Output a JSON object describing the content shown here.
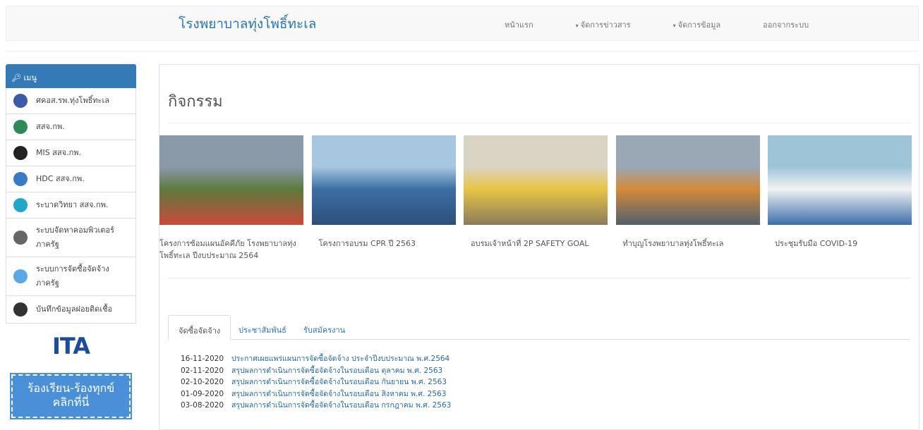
{
  "site": {
    "brand": "โรงพยาบาลทุ่งโพธิ์ทะเล"
  },
  "nav": [
    {
      "label": "หน้าแรก",
      "dropdown": false
    },
    {
      "label": "จัดการข่าวสาร",
      "dropdown": true
    },
    {
      "label": "จัดการข้อมูล",
      "dropdown": true
    },
    {
      "label": "ออกจากระบบ",
      "dropdown": false
    }
  ],
  "sidebar": {
    "header": "เมนู",
    "items": [
      {
        "label": "ศคอส.รพ.ทุ่งโพธิ์ทะเล",
        "icon": "emblem-icon",
        "color": "#3b5aa8"
      },
      {
        "label": "สสจ.กพ.",
        "icon": "health-office-icon",
        "color": "#2e8b57"
      },
      {
        "label": "MIS สสจ.กพ.",
        "icon": "network-icon",
        "color": "#222222"
      },
      {
        "label": "HDC สสจ.กพ.",
        "icon": "hdc-icon",
        "color": "#3a7bc8"
      },
      {
        "label": "ระบาดวิทยา สสจ.กพ.",
        "icon": "globe-icon",
        "color": "#23a7c9"
      },
      {
        "label": "ระบบจัดหาคอมพิวเตอร์ภาครัฐ",
        "icon": "computer-icon",
        "color": "#666666"
      },
      {
        "label": "ระบบการจัดซื้อจัดจ้างภาครัฐ",
        "icon": "procurement-icon",
        "color": "#5aa9e6"
      },
      {
        "label": "บันทึกข้อมูลฝอยติดเชื้อ",
        "icon": "biohazard-icon",
        "color": "#333333"
      }
    ],
    "ita_logo": "ITA",
    "complain_banner": [
      "ร้องเรียน-ร้องทุกข์",
      "คลิกที่นี่"
    ]
  },
  "main": {
    "title": "กิจกรรม",
    "activities": [
      {
        "caption": "โครงการซ้อมแผนอัคคีภัย โรงพยาบาลทุ่งโพธิ์ทะเล ปีงบประมาณ 2564",
        "colors": [
          "#8a9aa8",
          "#5d7a3e",
          "#c94a3a"
        ]
      },
      {
        "caption": "โครงการอบรม CPR ปี 2563",
        "colors": [
          "#a7c7e0",
          "#3c6fa5",
          "#2f4f7a"
        ]
      },
      {
        "caption": "อบรมเจ้าหน้าที่ 2P SAFETY GOAL",
        "colors": [
          "#d9d4c4",
          "#e8c545",
          "#8a7a5a"
        ]
      },
      {
        "caption": "ทำบุญโรงพยาบาลทุ่งโพธิ์ทะเล",
        "colors": [
          "#9aa7b4",
          "#d48a3a",
          "#50606e"
        ]
      },
      {
        "caption": "ประชุมรับมือ COVID-19",
        "colors": [
          "#9ec4d8",
          "#f2f2f2",
          "#3a6ea8"
        ]
      }
    ],
    "tabs": [
      {
        "label": "จัดซื้อจัดจ้าง",
        "active": true
      },
      {
        "label": "ประชาสัมพันธ์",
        "active": false
      },
      {
        "label": "รับสมัครงาน",
        "active": false
      }
    ],
    "news": [
      {
        "date": "16-11-2020",
        "title": "ประกาศเผยแพร่แผนการจัดซื้อจัดจ้าง ประจำปีงบประมาณ พ.ศ.2564"
      },
      {
        "date": "02-11-2020",
        "title": "สรุปผลการดำเนินการจัดซื้อจัดจ้างในรอบเดือน ตุลาคม พ.ศ. 2563"
      },
      {
        "date": "02-10-2020",
        "title": "สรุปผลการดำเนินการจัดซื้อจัดจ้างในรอบเดือน กันยายน พ.ศ. 2563"
      },
      {
        "date": "01-09-2020",
        "title": "สรุปผลการดำเนินการจัดซื้อจัดจ้างในรอบเดือน สิงหาคม พ.ศ. 2563"
      },
      {
        "date": "03-08-2020",
        "title": "สรุปผลการดำเนินการจัดซื้อจัดจ้างในรอบเดือน กรกฎาคม พ.ศ. 2563"
      }
    ]
  }
}
